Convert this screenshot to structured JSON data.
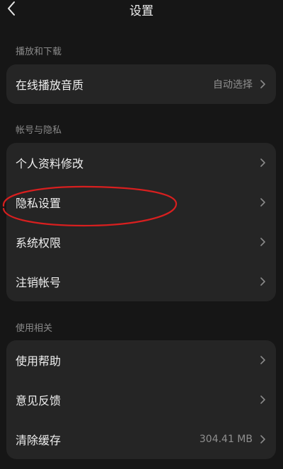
{
  "header": {
    "title": "设置",
    "back_icon": "chevron-left-icon"
  },
  "sections": [
    {
      "label": "播放和下载",
      "items": [
        {
          "label": "在线播放音质",
          "value": "自动选择"
        }
      ]
    },
    {
      "label": "帐号与隐私",
      "items": [
        {
          "label": "个人资料修改",
          "value": ""
        },
        {
          "label": "隐私设置",
          "value": ""
        },
        {
          "label": "系统权限",
          "value": ""
        },
        {
          "label": "注销帐号",
          "value": ""
        }
      ]
    },
    {
      "label": "使用相关",
      "items": [
        {
          "label": "使用帮助",
          "value": ""
        },
        {
          "label": "意见反馈",
          "value": ""
        },
        {
          "label": "清除缓存",
          "value": "304.41 MB"
        }
      ]
    }
  ],
  "colors": {
    "background": "#161616",
    "card": "#252525",
    "highlight_annotation": "#d81f1f"
  }
}
